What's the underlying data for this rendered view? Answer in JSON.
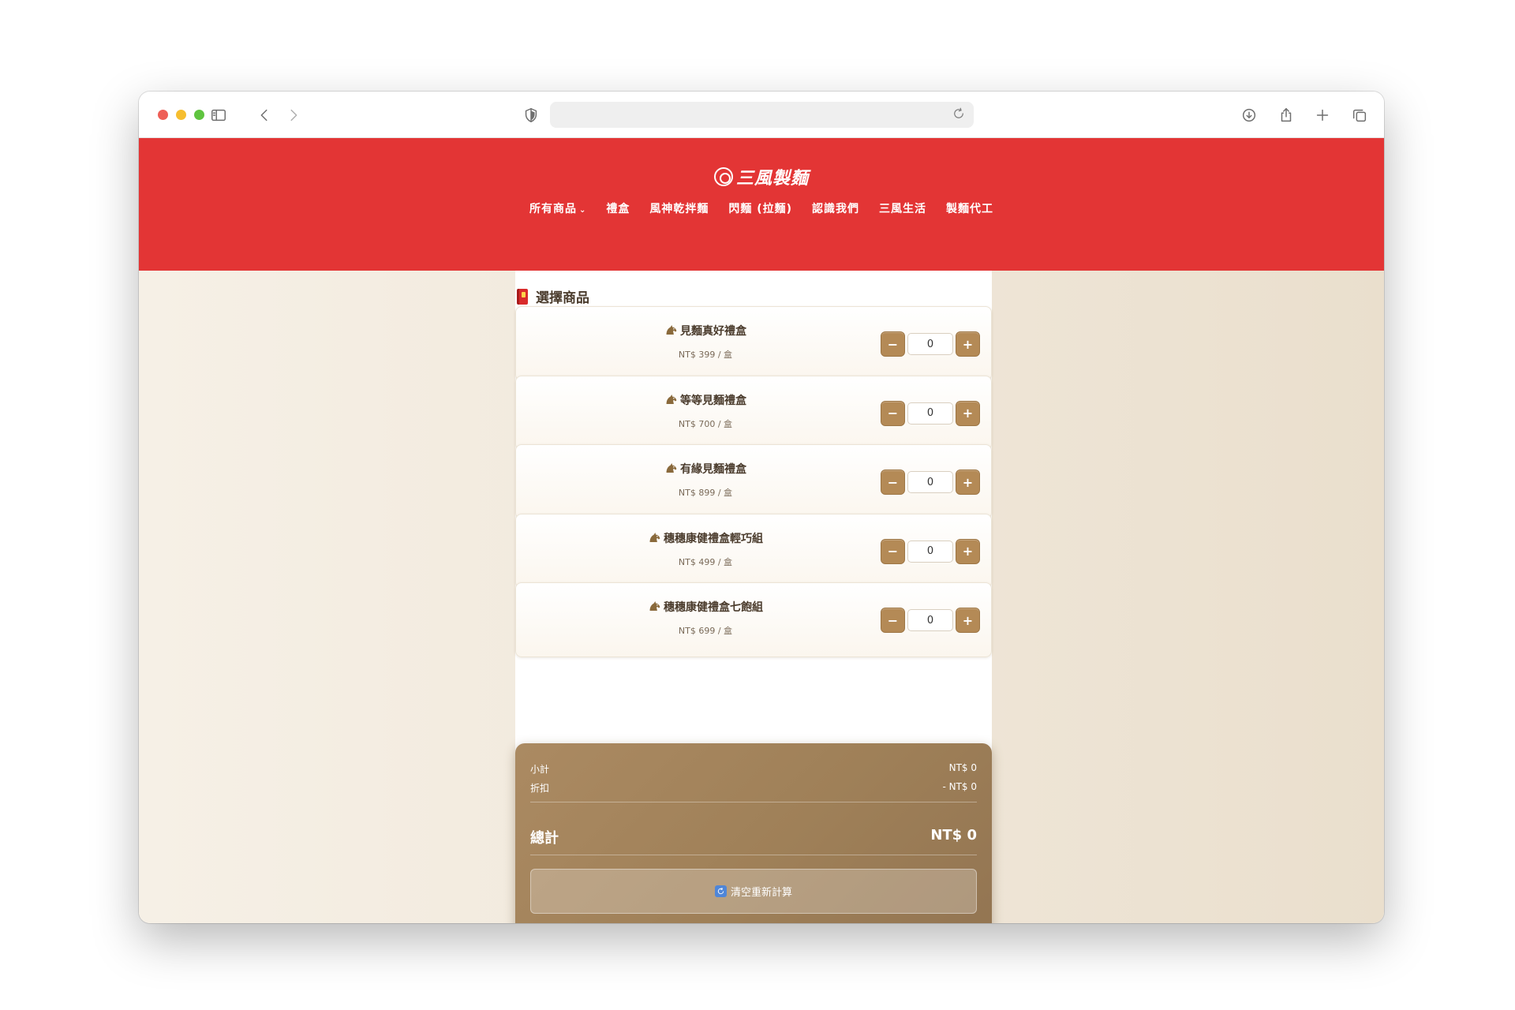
{
  "browser": {
    "address_text": ""
  },
  "site": {
    "logo_text": "三風製麵",
    "nav": [
      {
        "label": "所有商品",
        "has_dropdown": true
      },
      {
        "label": "禮盒"
      },
      {
        "label": "風神乾拌麵"
      },
      {
        "label": "閃麵 (拉麵)"
      },
      {
        "label": "認識我們"
      },
      {
        "label": "三風生活"
      },
      {
        "label": "製麵代工"
      }
    ],
    "colors": {
      "header": "#e33535",
      "accent": "#b48a56"
    }
  },
  "section": {
    "title": "選擇商品"
  },
  "products": [
    {
      "name": "見麵真好禮盒",
      "price": "NT$ 399 / 盒",
      "qty": "0",
      "minus": "−",
      "plus": "+"
    },
    {
      "name": "等等見麵禮盒",
      "price": "NT$ 700 / 盒",
      "qty": "0",
      "minus": "−",
      "plus": "+"
    },
    {
      "name": "有緣見麵禮盒",
      "price": "NT$ 899 / 盒",
      "qty": "0",
      "minus": "−",
      "plus": "+"
    },
    {
      "name": "穗穗康健禮盒輕巧組",
      "price": "NT$ 499 / 盒",
      "qty": "0",
      "minus": "−",
      "plus": "+"
    },
    {
      "name": "穗穗康健禮盒七飽組",
      "price": "NT$ 699 / 盒",
      "qty": "0",
      "minus": "−",
      "plus": "+"
    }
  ],
  "summary": {
    "subtotal_label": "小計",
    "subtotal_value": "NT$ 0",
    "discount_label": "折扣",
    "discount_value": "- NT$ 0",
    "total_label": "總計",
    "total_value": "NT$ 0",
    "reset_label": "清空重新計算"
  }
}
